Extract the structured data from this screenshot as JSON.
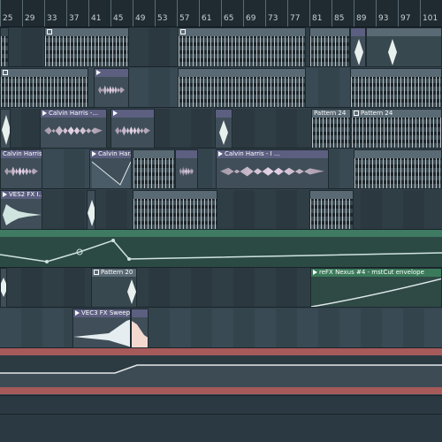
{
  "ruler": {
    "bars": [
      "25",
      "29",
      "33",
      "37",
      "41",
      "45",
      "49",
      "53",
      "57",
      "61",
      "65",
      "69",
      "73",
      "77",
      "81",
      "85",
      "89",
      "93",
      "97",
      "101"
    ]
  },
  "clips": {
    "calvin_harris_1": "Calvin Harris -...",
    "pattern_24_a": "Pattern 24",
    "pattern_24_b": "Pattern 24",
    "calvin_harris_2": "Calvin Harris -...",
    "calvin_har_short": "Calvin Har...",
    "calvin_harris_3": "Calvin Harris - I ...",
    "ves2_fx": "VES2 FX I...",
    "pattern_20": "Pattern 20",
    "refx_nexus": "reFX Nexus #4 - mstCut envelope",
    "vec3_fx_sweep": "VEC3 FX Sweep ..."
  },
  "colors": {
    "accent_green": "#3f7a63",
    "accent_red": "#a65a5a",
    "audio_title": "#5c5f80",
    "pattern_title": "#5a6a74"
  }
}
